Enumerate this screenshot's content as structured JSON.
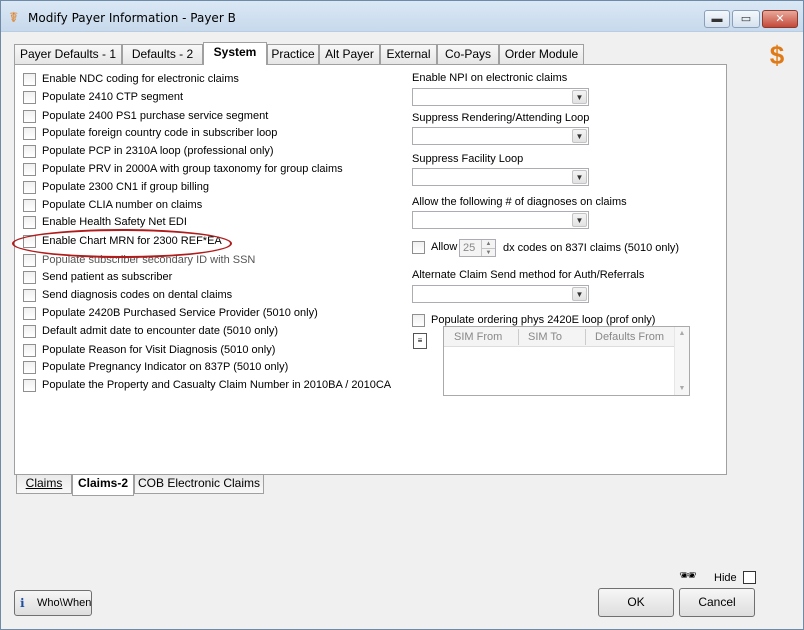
{
  "window": {
    "title": "Modify Payer Information - Payer B",
    "minimize_glyph": "▬",
    "maximize_glyph": "▭",
    "close_glyph": "✕",
    "app_icon": "asclepius-icon"
  },
  "tabs": [
    {
      "label": "Payer Defaults - 1",
      "active": false
    },
    {
      "label": "Defaults - 2",
      "active": false
    },
    {
      "label": "System",
      "active": true
    },
    {
      "label": "Practice",
      "active": false
    },
    {
      "label": "Alt Payer",
      "active": false
    },
    {
      "label": "External",
      "active": false
    },
    {
      "label": "Co-Pays",
      "active": false
    },
    {
      "label": "Order Module",
      "active": false
    }
  ],
  "checkboxes": [
    {
      "label": "Enable NDC coding for electronic claims",
      "checked": false
    },
    {
      "label": "Populate 2410 CTP segment",
      "checked": false
    },
    {
      "label": "Populate 2400 PS1 purchase service segment",
      "checked": false
    },
    {
      "label": "Populate foreign country code in subscriber loop",
      "checked": false
    },
    {
      "label": "Populate PCP in 2310A loop (professional only)",
      "checked": false
    },
    {
      "label": "Populate PRV in 2000A with group taxonomy for group claims",
      "checked": false
    },
    {
      "label": "Populate 2300 CN1 if group billing",
      "checked": false
    },
    {
      "label": "Populate CLIA number on claims",
      "checked": false
    },
    {
      "label": "Enable Health Safety Net EDI",
      "checked": false
    },
    {
      "label": "Enable Chart MRN for 2300 REF*EA",
      "checked": false
    },
    {
      "label": "Populate subscriber secondary ID with SSN",
      "checked": false
    },
    {
      "label": "Send patient as subscriber",
      "checked": false
    },
    {
      "label": "Send diagnosis codes on dental claims",
      "checked": false
    },
    {
      "label": "Populate 2420B Purchased Service Provider (5010 only)",
      "checked": false
    },
    {
      "label": "Default admit date to encounter date (5010 only)",
      "checked": false
    },
    {
      "label": "Populate Reason for Visit Diagnosis (5010 only)",
      "checked": false
    },
    {
      "label": "Populate Pregnancy Indicator on 837P (5010 only)",
      "checked": false
    },
    {
      "label": "Populate the Property and Casualty Claim Number in  2010BA / 2010CA",
      "checked": false
    }
  ],
  "right": {
    "npi_label": "Enable NPI on electronic claims",
    "npi_value": "",
    "suppress_rendering_label": "Suppress Rendering/Attending Loop",
    "suppress_rendering_value": "",
    "suppress_facility_label": "Suppress Facility Loop",
    "suppress_facility_value": "",
    "diagnoses_label": "Allow the following # of diagnoses on claims",
    "diagnoses_value": "",
    "allow_label": "Allow",
    "allow_value": "25",
    "allow_suffix": "dx codes on 837I claims (5010 only)",
    "alternate_label": "Alternate Claim Send method for Auth/Referrals",
    "alternate_value": "",
    "ordering_label": "Populate ordering phys 2420E loop (prof only)",
    "combo_arrow": "▼",
    "spin_up": "▲",
    "spin_down": "▼",
    "sim_icon": "document-icon",
    "sim_columns": [
      "SIM From",
      "SIM To",
      "Defaults From"
    ],
    "scroll_up": "▲",
    "scroll_down": "▼"
  },
  "bottom_tabs": [
    {
      "label": "Claims",
      "active": false
    },
    {
      "label": "Claims-2",
      "active": true
    },
    {
      "label": "COB Electronic Claims",
      "active": false
    }
  ],
  "footer": {
    "who_when_label": "Who\\When",
    "hide_label": "Hide",
    "ok_label": "OK",
    "cancel_label": "Cancel"
  },
  "colors": {
    "highlight_oval": "#b01c1c",
    "brand_orange": "#e07a16"
  }
}
